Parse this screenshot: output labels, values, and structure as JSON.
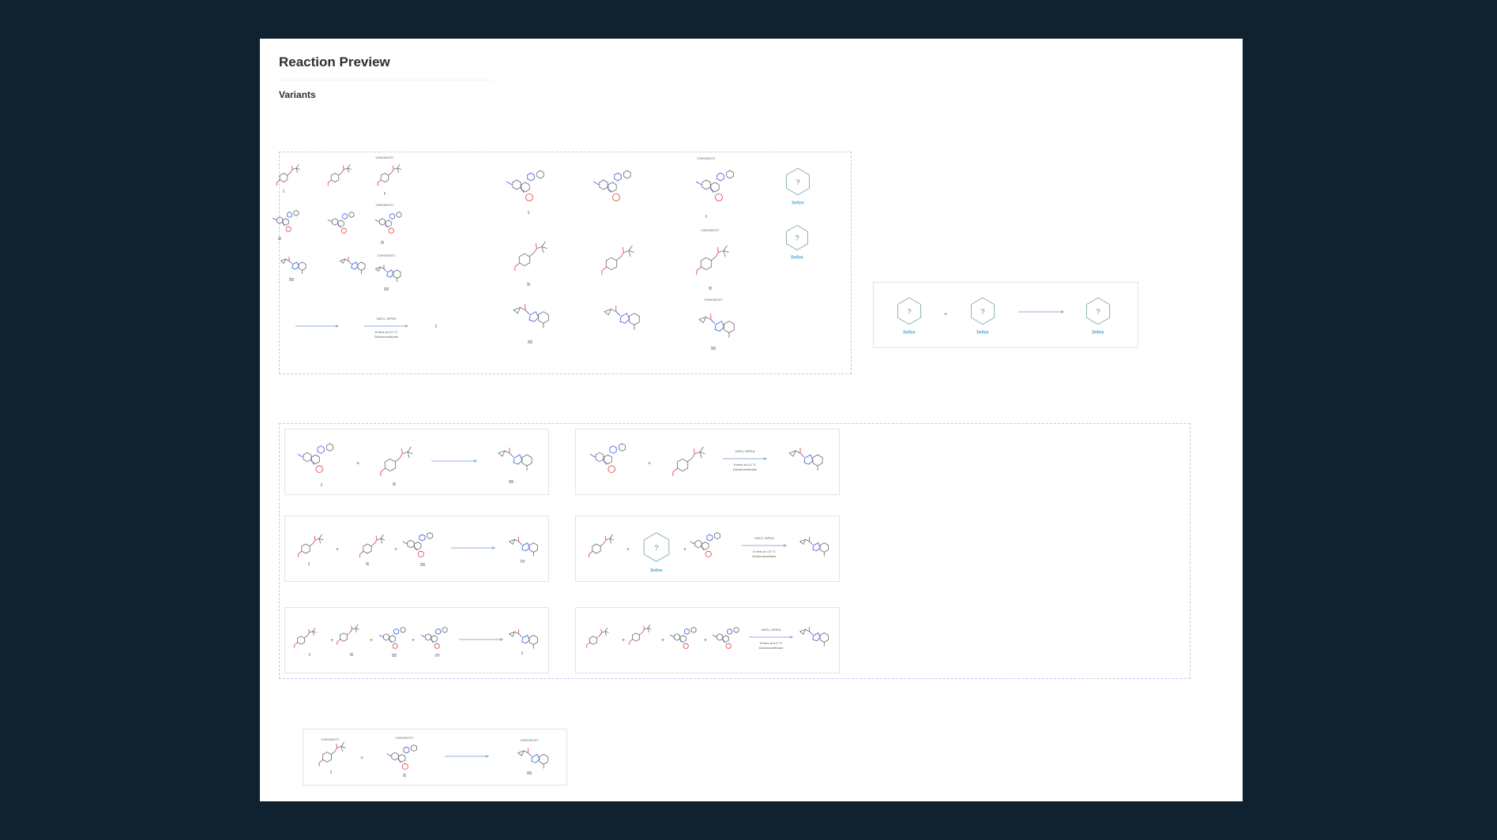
{
  "page": {
    "title": "Reaction Preview",
    "subtitle": "Variants"
  },
  "labels": {
    "roman": [
      "I",
      "II",
      "III",
      "IV"
    ],
    "code": "C9H10N7O7",
    "define": "Define",
    "unknown": "?",
    "plus": "+",
    "reagent": "HATU, DIPEA",
    "condition": "8 mins at 4.0 °C",
    "solvent": "Dichloromethane"
  },
  "icons": {
    "reaction_arrow": "right-arrow",
    "undefined_molecule": "hexagon-question"
  },
  "colors": {
    "background": "#10212f",
    "canvas": "#ffffff",
    "dashed_border": "#c2c6f0",
    "bond": "#6a6a6a",
    "nitrogen": "#3a5fe0",
    "oxygen": "#e03a3a",
    "arrow": "#8fb0d8",
    "define": "#3aa0d8"
  }
}
